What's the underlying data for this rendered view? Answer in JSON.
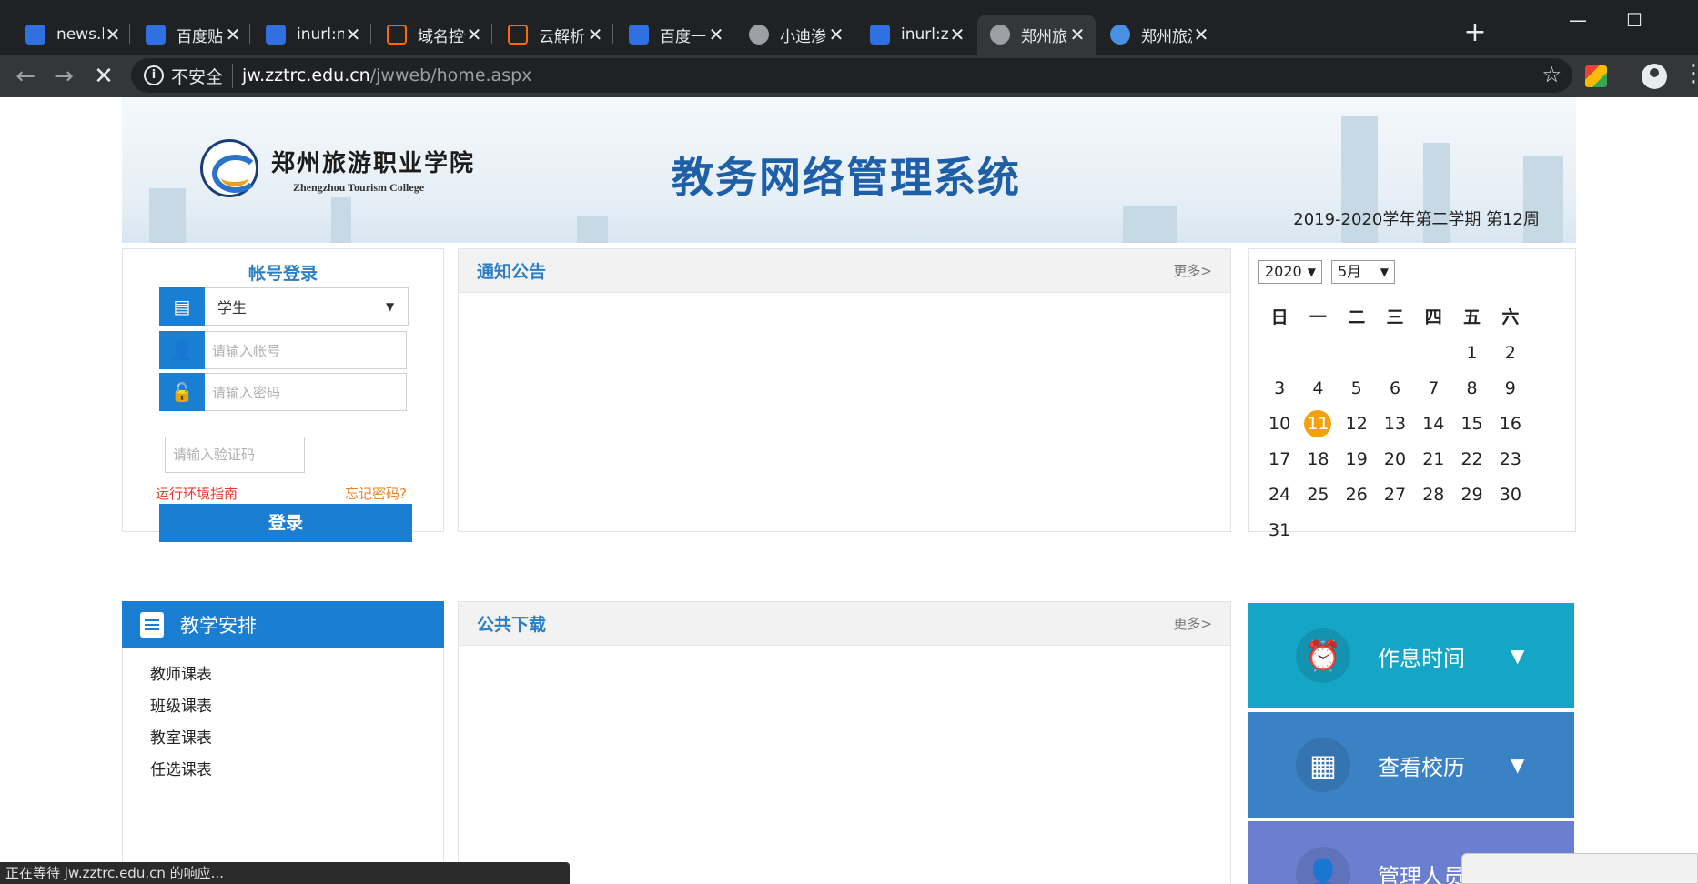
{
  "browser": {
    "tabs": [
      {
        "title": "news.baic",
        "icon": "baidu-paw-icon",
        "active": false
      },
      {
        "title": "百度贴吧-",
        "icon": "baidu-paw-icon",
        "active": false
      },
      {
        "title": "inurl:new",
        "icon": "baidu-paw-icon",
        "active": false
      },
      {
        "title": "域名控制",
        "icon": "aliyun-icon",
        "active": false
      },
      {
        "title": "云解析 D",
        "icon": "aliyun-icon",
        "active": false
      },
      {
        "title": "百度一下",
        "icon": "baidu-paw-icon",
        "active": false
      },
      {
        "title": "小迪渗透",
        "icon": "globe-icon",
        "active": false
      },
      {
        "title": "inurl:zztr",
        "icon": "baidu-paw-icon",
        "active": false
      },
      {
        "title": "郑州旅游",
        "icon": "loading-icon",
        "active": true
      },
      {
        "title": "郑州旅游",
        "icon": "chrome-icon",
        "active": false
      }
    ],
    "close_glyph": "✕",
    "new_tab_glyph": "+",
    "window_controls": {
      "minimize": "—",
      "maximize": "☐"
    },
    "nav": {
      "back": "←",
      "forward": "→",
      "stop": "✕"
    },
    "address": {
      "info": "i",
      "security_label": "不安全",
      "host": "jw.zztrc.edu.cn",
      "path": "/jwweb/home.aspx"
    },
    "star": "☆",
    "menu": "⋮",
    "status_text": "正在等待 jw.zztrc.edu.cn 的响应..."
  },
  "banner": {
    "college_name_cn": "郑州旅游职业学院",
    "college_name_en": "Zhengzhou Tourism College",
    "system_title": "教务网络管理系统",
    "term": "2019-2020学年第二学期  第12周"
  },
  "login": {
    "title": "帐号登录",
    "role_value": "学生",
    "role_caret": "▼",
    "account_placeholder": "请输入帐号",
    "password_placeholder": "请输入密码",
    "captcha_placeholder": "请输入验证码",
    "env_guide": "运行环境指南",
    "forgot": "忘记密码?",
    "submit": "登录"
  },
  "notices": {
    "title": "通知公告",
    "more": "更多>"
  },
  "downloads": {
    "title": "公共下载",
    "more": "更多>"
  },
  "calendar": {
    "year": "2020",
    "month": "5月",
    "caret": "▼",
    "weekdays": [
      "日",
      "一",
      "二",
      "三",
      "四",
      "五",
      "六"
    ],
    "days": [
      "",
      "",
      "",
      "",
      "",
      "1",
      "2",
      "3",
      "4",
      "5",
      "6",
      "7",
      "8",
      "9",
      "10",
      "11",
      "12",
      "13",
      "14",
      "15",
      "16",
      "17",
      "18",
      "19",
      "20",
      "21",
      "22",
      "23",
      "24",
      "25",
      "26",
      "27",
      "28",
      "29",
      "30",
      "31"
    ],
    "today": "11"
  },
  "teaching": {
    "title": "教学安排",
    "items": [
      "教师课表",
      "班级课表",
      "教室课表",
      "任选课表"
    ]
  },
  "tiles": [
    {
      "label": "作息时间",
      "icon": "alarm-clock-icon",
      "caret": "▼",
      "color": "#15a5c6"
    },
    {
      "label": "查看校历",
      "icon": "calendar-icon",
      "caret": "▼",
      "color": "#3b82c4"
    },
    {
      "label": "管理人员",
      "icon": "user-icon",
      "caret": "",
      "color": "#6b7fd0"
    }
  ],
  "colors": {
    "accent": "#1a7fd3",
    "title_blue": "#1f5fa8",
    "today": "#f5a10f",
    "link_red": "#e23b2e"
  }
}
